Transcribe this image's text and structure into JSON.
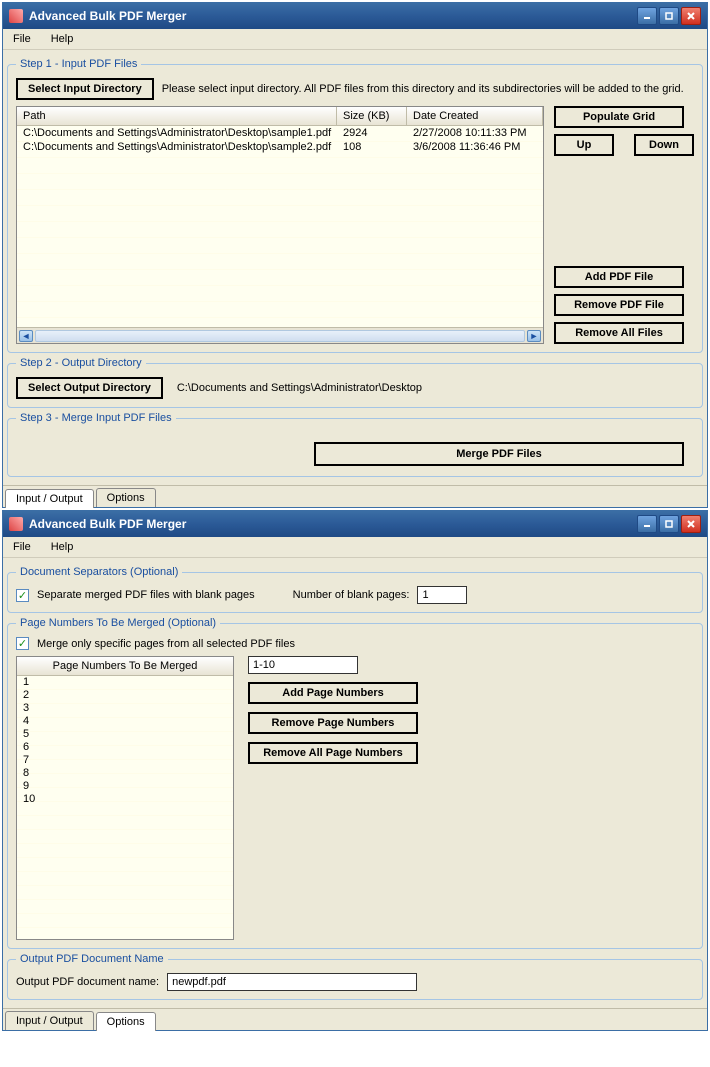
{
  "window1": {
    "title": "Advanced Bulk PDF Merger",
    "menu": {
      "file": "File",
      "help": "Help"
    },
    "step1": {
      "legend": "Step 1 - Input PDF Files",
      "select_dir_btn": "Select Input Directory",
      "hint": "Please select input directory. All PDF files from this directory and its subdirectories will be added to the grid.",
      "grid": {
        "headers": {
          "path": "Path",
          "size": "Size (KB)",
          "date": "Date Created"
        },
        "rows": [
          {
            "path": "C:\\Documents and Settings\\Administrator\\Desktop\\sample1.pdf",
            "size": "2924",
            "date": "2/27/2008 10:11:33 PM"
          },
          {
            "path": "C:\\Documents and Settings\\Administrator\\Desktop\\sample2.pdf",
            "size": "108",
            "date": "3/6/2008 11:36:46 PM"
          }
        ]
      },
      "populate_btn": "Populate Grid",
      "up_btn": "Up",
      "down_btn": "Down",
      "add_btn": "Add PDF File",
      "remove_btn": "Remove PDF File",
      "remove_all_btn": "Remove All Files"
    },
    "step2": {
      "legend": "Step 2 - Output Directory",
      "select_btn": "Select Output Directory",
      "path": "C:\\Documents and Settings\\Administrator\\Desktop"
    },
    "step3": {
      "legend": "Step 3 - Merge Input PDF Files",
      "merge_btn": "Merge PDF Files"
    },
    "tabs": {
      "io": "Input / Output",
      "options": "Options"
    }
  },
  "window2": {
    "title": "Advanced Bulk PDF Merger",
    "menu": {
      "file": "File",
      "help": "Help"
    },
    "separators": {
      "legend": "Document Separators (Optional)",
      "checkbox_label": "Separate merged PDF files with blank pages",
      "count_label": "Number of blank pages:",
      "count_value": "1"
    },
    "pages": {
      "legend": "Page Numbers To Be Merged (Optional)",
      "checkbox_label": "Merge only specific pages from all selected PDF files",
      "grid_header": "Page Numbers To Be Merged",
      "rows": [
        "1",
        "2",
        "3",
        "4",
        "5",
        "6",
        "7",
        "8",
        "9",
        "10"
      ],
      "range_input": "1-10",
      "add_btn": "Add Page Numbers",
      "remove_btn": "Remove Page Numbers",
      "remove_all_btn": "Remove All Page Numbers"
    },
    "output": {
      "legend": "Output PDF Document Name",
      "label": "Output PDF document name:",
      "value": "newpdf.pdf"
    },
    "tabs": {
      "io": "Input / Output",
      "options": "Options"
    }
  }
}
